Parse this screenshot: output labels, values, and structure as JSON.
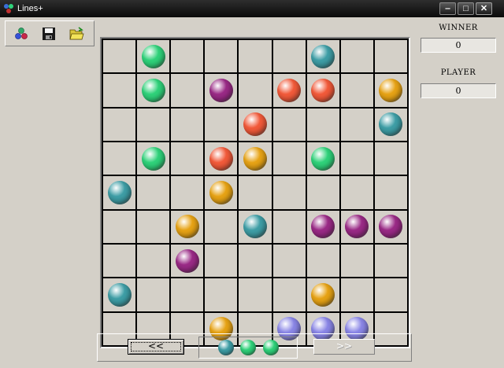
{
  "window": {
    "title": "Lines+",
    "minimize_glyph": "‒",
    "maximize_glyph": "□",
    "close_glyph": "✕"
  },
  "toolbar": {
    "buttons": [
      {
        "name": "new-game-icon"
      },
      {
        "name": "save-icon"
      },
      {
        "name": "open-folder-icon"
      }
    ]
  },
  "colors": {
    "green": "#2fd27a",
    "teal": "#3e9ea6",
    "purple": "#9a2a86",
    "red": "#f25a3a",
    "orange": "#e7a315",
    "lavender": "#8a86e6"
  },
  "board": {
    "rows": 9,
    "cols": 9,
    "cells": [
      [
        "",
        "green",
        "",
        "",
        "",
        "",
        "teal",
        "",
        ""
      ],
      [
        "",
        "green",
        "",
        "purple",
        "",
        "red",
        "red",
        "",
        "orange"
      ],
      [
        "",
        "",
        "",
        "",
        "red",
        "",
        "",
        "",
        "teal"
      ],
      [
        "",
        "green",
        "",
        "red",
        "orange",
        "",
        "green",
        "",
        ""
      ],
      [
        "teal",
        "",
        "",
        "orange",
        "",
        "",
        "",
        "",
        ""
      ],
      [
        "",
        "",
        "orange",
        "",
        "teal",
        "",
        "purple",
        "purple",
        "purple"
      ],
      [
        "",
        "",
        "purple",
        "",
        "",
        "",
        "",
        "",
        ""
      ],
      [
        "teal",
        "",
        "",
        "",
        "",
        "",
        "orange",
        "",
        ""
      ],
      [
        "",
        "",
        "",
        "orange",
        "",
        "lavender",
        "lavender",
        "lavender",
        ""
      ]
    ]
  },
  "scores": {
    "winner_label": "WINNER",
    "winner_value": "0",
    "player_label": "PLAYER",
    "player_value": "0"
  },
  "controls": {
    "prev_label": "<<",
    "next_label": ">>"
  },
  "next_balls": [
    "teal",
    "green",
    "green"
  ]
}
